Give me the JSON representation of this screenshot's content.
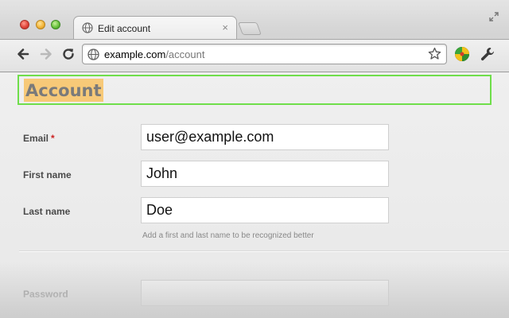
{
  "browser": {
    "tab_title": "Edit account",
    "tab_close": "×",
    "url_host": "example.com",
    "url_path": "/account"
  },
  "page": {
    "title": "Account",
    "fields": {
      "email": {
        "label": "Email",
        "required_marker": "*",
        "value": "user@example.com"
      },
      "first_name": {
        "label": "First name",
        "value": "John"
      },
      "last_name": {
        "label": "Last name",
        "value": "Doe",
        "hint": "Add a first and last name to be recognized better"
      },
      "password": {
        "label": "Password",
        "value": ""
      }
    }
  },
  "colors": {
    "highlight": "#f7c978",
    "focus_outline": "#6fde4a",
    "required": "#cc2222"
  },
  "icons": {
    "favicon": "globe-icon",
    "back": "back-arrow-icon",
    "forward": "forward-arrow-icon",
    "reload": "reload-icon",
    "bookmark": "star-icon",
    "extension": "extension-icon",
    "menu": "wrench-icon",
    "fullscreen": "resize-icon"
  }
}
